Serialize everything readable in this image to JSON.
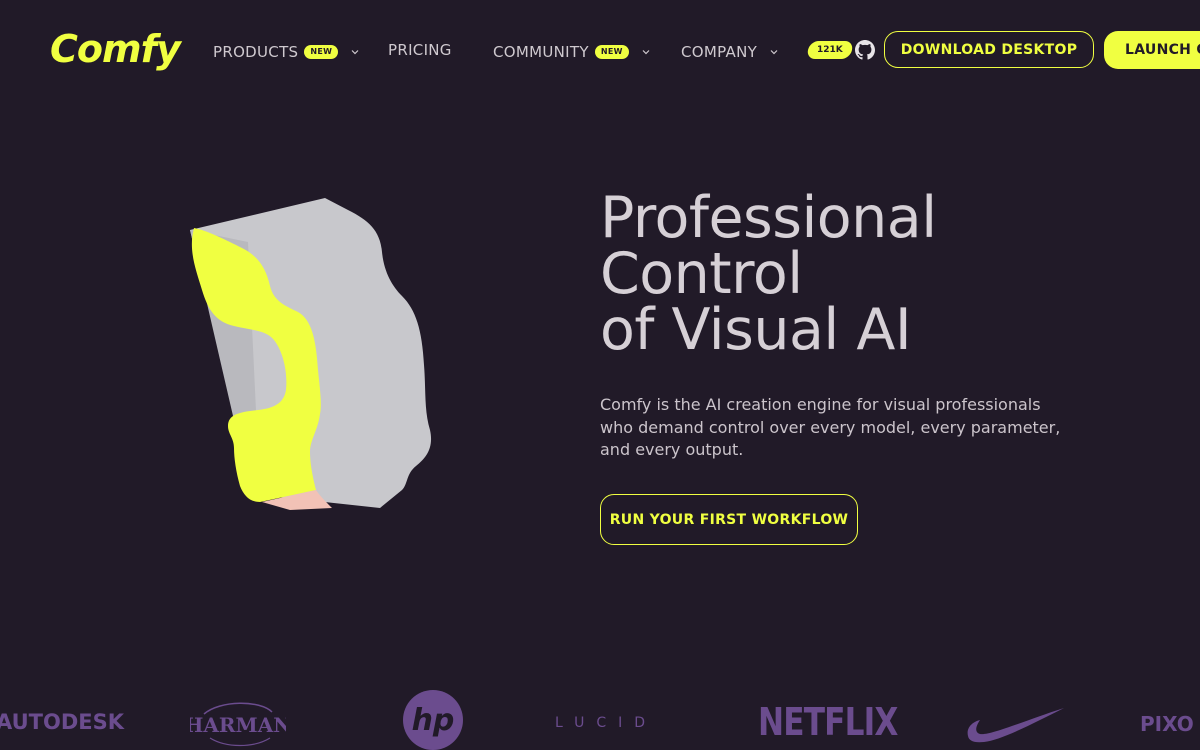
{
  "nav": {
    "logo_text": "Comfy",
    "items": [
      {
        "label": "PRODUCTS",
        "badge": "NEW",
        "has_dropdown": true
      },
      {
        "label": "PRICING",
        "badge": "",
        "has_dropdown": false
      },
      {
        "label": "COMMUNITY",
        "badge": "NEW",
        "has_dropdown": true
      },
      {
        "label": "COMPANY",
        "badge": "",
        "has_dropdown": true
      }
    ],
    "github_stars": "121K",
    "download_label": "DOWNLOAD DESKTOP",
    "launch_label": "LAUNCH C"
  },
  "hero": {
    "title_lines": [
      "Professional",
      "Control",
      "of Visual AI"
    ],
    "description": "Comfy is the AI creation engine for visual professionals who demand control over every model, every parameter, and every output.",
    "cta_label": "RUN YOUR FIRST WORKFLOW"
  },
  "brands": {
    "autodesk": "AUTODESK",
    "harman": "HARMAN",
    "hp": "hp",
    "lucid": "LUCID",
    "netflix": "NETFLIX",
    "nike": "Nike",
    "pixo": "PIXO"
  },
  "colors": {
    "background": "#211a28",
    "accent": "#f0ff41",
    "text": "#d6d0d6",
    "brand_logos": "#6b4c8e"
  }
}
